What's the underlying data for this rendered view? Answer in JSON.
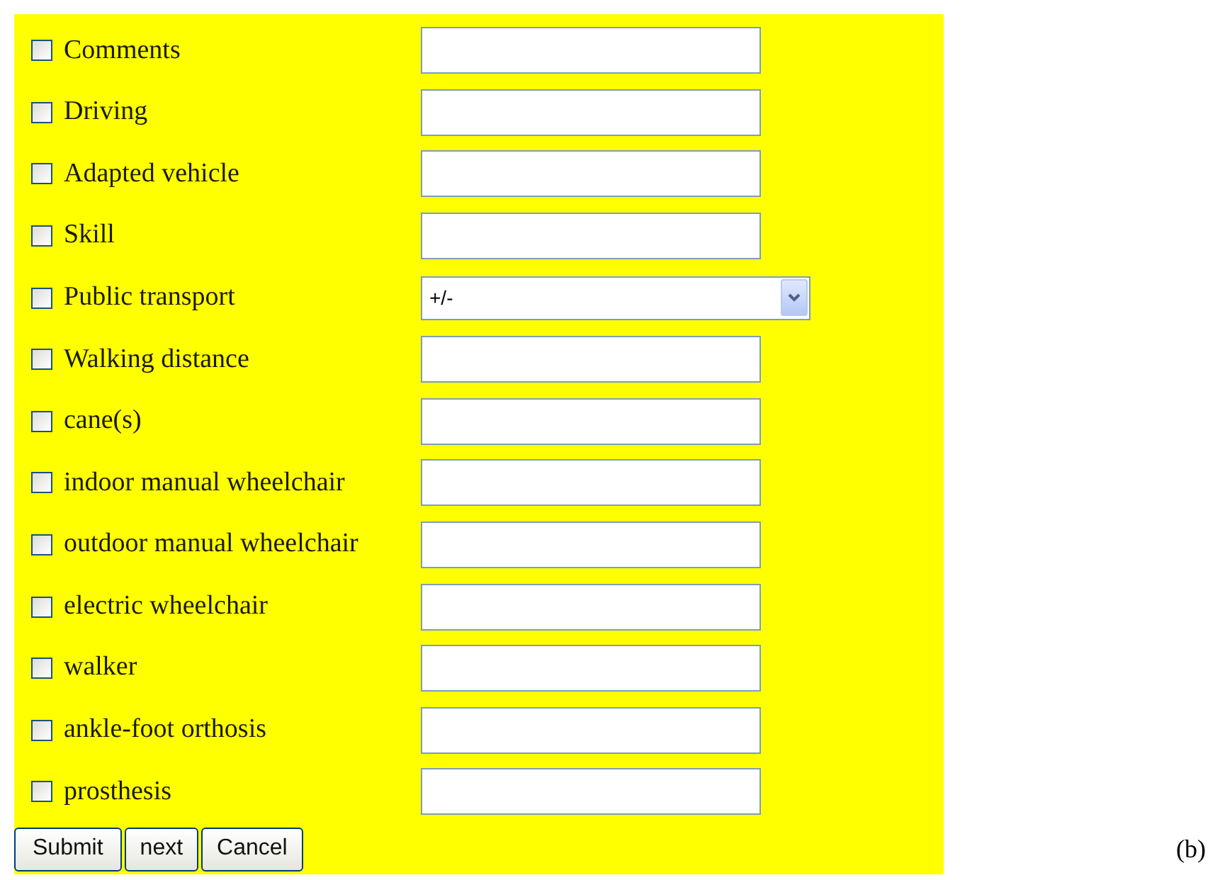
{
  "rows": [
    {
      "label": "Comments",
      "checked": false,
      "kind": "text"
    },
    {
      "label": "Driving",
      "checked": false,
      "kind": "text"
    },
    {
      "label": "Adapted vehicle",
      "checked": false,
      "kind": "text"
    },
    {
      "label": "Skill",
      "checked": false,
      "kind": "text"
    },
    {
      "label": "Public transport",
      "checked": false,
      "kind": "select",
      "value": "+/-"
    },
    {
      "label": "Walking distance",
      "checked": false,
      "kind": "text"
    },
    {
      "label": "cane(s)",
      "checked": false,
      "kind": "text"
    },
    {
      "label": "indoor manual wheelchair",
      "checked": false,
      "kind": "text"
    },
    {
      "label": "outdoor manual wheelchair",
      "checked": false,
      "kind": "text"
    },
    {
      "label": "electric wheelchair",
      "checked": false,
      "kind": "text"
    },
    {
      "label": "walker",
      "checked": false,
      "kind": "text"
    },
    {
      "label": "ankle-foot orthosis",
      "checked": false,
      "kind": "text"
    },
    {
      "label": "prosthesis",
      "checked": false,
      "kind": "text"
    }
  ],
  "buttons": [
    "Submit",
    "next",
    "Cancel"
  ],
  "caption": "(b)"
}
